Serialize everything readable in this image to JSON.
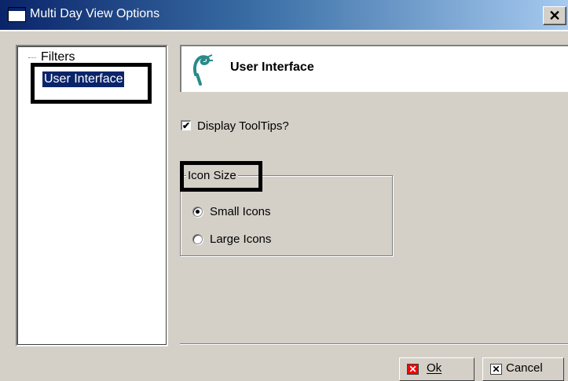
{
  "window": {
    "title": "Multi Day View Options",
    "close_glyph": "✕"
  },
  "tree": {
    "items": [
      {
        "label": "Filters"
      },
      {
        "label": "User Interface"
      }
    ]
  },
  "header": {
    "title": "User Interface",
    "icon": "tool-logo-icon"
  },
  "options": {
    "tooltips_label": "Display ToolTips?",
    "tooltips_checked": true,
    "icon_size_group": "Icon Size",
    "radio_options": [
      {
        "label": "Small Icons",
        "selected": true
      },
      {
        "label": "Large Icons",
        "selected": false
      }
    ]
  },
  "buttons": {
    "ok": {
      "label": "Ok",
      "icon": "red-x-icon"
    },
    "cancel": {
      "label": "Cancel",
      "icon": "x-icon"
    }
  },
  "colors": {
    "titlebar_start": "#0a246a",
    "titlebar_end": "#a6caf0",
    "face": "#d4d0c8",
    "selection": "#0a246a",
    "ok_icon": "#ff0000"
  }
}
